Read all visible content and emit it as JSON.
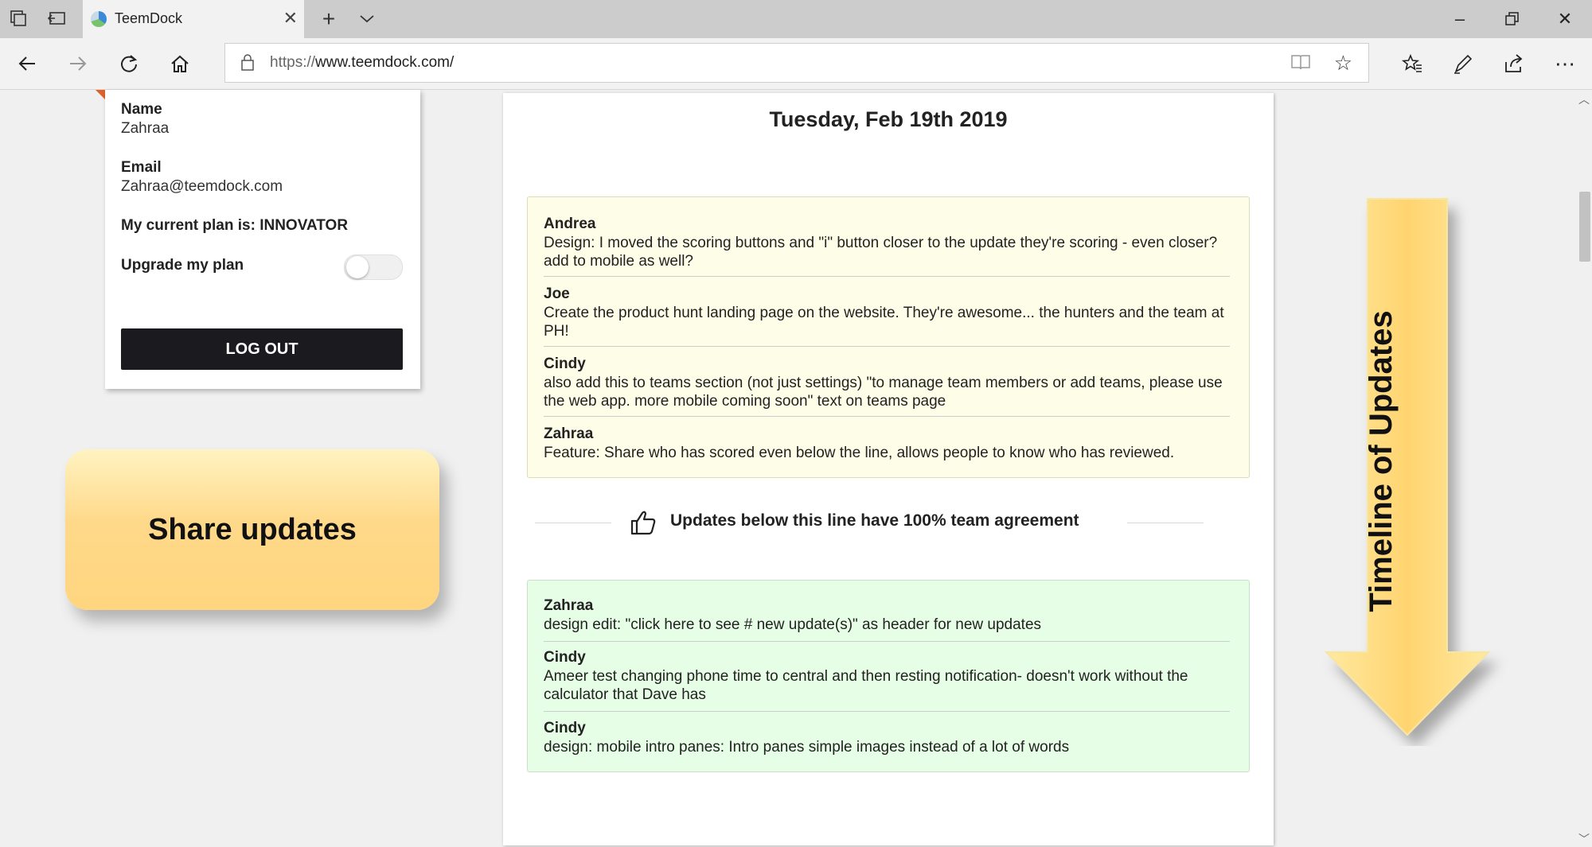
{
  "browser": {
    "tab_title": "TeemDock",
    "url_prefix": "https://",
    "url_domain": "www.teemdock.com/",
    "icons": [
      "tab-actions-icon",
      "set-aside-tabs-icon",
      "favicon",
      "close-tab-icon",
      "new-tab-icon",
      "tab-preview-icon",
      "minimize-icon",
      "restore-icon",
      "close-window-icon",
      "back-icon",
      "forward-icon",
      "refresh-icon",
      "home-icon",
      "lock-icon",
      "reading-view-icon",
      "favorite-star-icon",
      "favorites-icon",
      "notes-icon",
      "share-icon",
      "more-icon"
    ]
  },
  "profile": {
    "name_label": "Name",
    "name_value": "Zahraa",
    "email_label": "Email",
    "email_value": "Zahraa@teemdock.com",
    "plan_text": "My current plan is: INNOVATOR",
    "upgrade_label": "Upgrade my plan",
    "upgrade_enabled": false,
    "logout_label": "LOG OUT"
  },
  "callouts": {
    "share": "Share updates",
    "timeline": "Timeline of Updates"
  },
  "main": {
    "date": "Tuesday, Feb 19th 2019",
    "pending_updates": [
      {
        "name": "Andrea",
        "text": "Design: I moved the scoring buttons and \"i\" button closer to the update they're scoring - even closer? add to mobile as well?"
      },
      {
        "name": "Joe",
        "text": "Create the product hunt landing page on the website. They're awesome... the hunters and the team at PH!"
      },
      {
        "name": "Cindy",
        "text": "also add this to teams section (not just settings) \"to manage team members or add teams, please use the web app. more mobile coming soon\" text on teams page"
      },
      {
        "name": "Zahraa",
        "text": "Feature: Share who has scored even below the line, allows people to know who has reviewed."
      }
    ],
    "agreement_text": "Updates below this line have 100% team agreement",
    "agreed_updates": [
      {
        "name": "Zahraa",
        "text": "design edit: \"click here to see # new update(s)\" as header for new updates"
      },
      {
        "name": "Cindy",
        "text": "Ameer test changing phone time to central and then resting notification- doesn't work without the calculator that Dave has"
      },
      {
        "name": "Cindy",
        "text": "design: mobile intro panes: Intro panes simple images instead of a lot of words"
      }
    ]
  },
  "colors": {
    "pending_bg": "#fefee8",
    "agreed_bg": "#e6fde6",
    "logout_bg": "#1b1b1f",
    "callout_yellow": "#ffd98a",
    "accent_orange": "#e0602a"
  }
}
